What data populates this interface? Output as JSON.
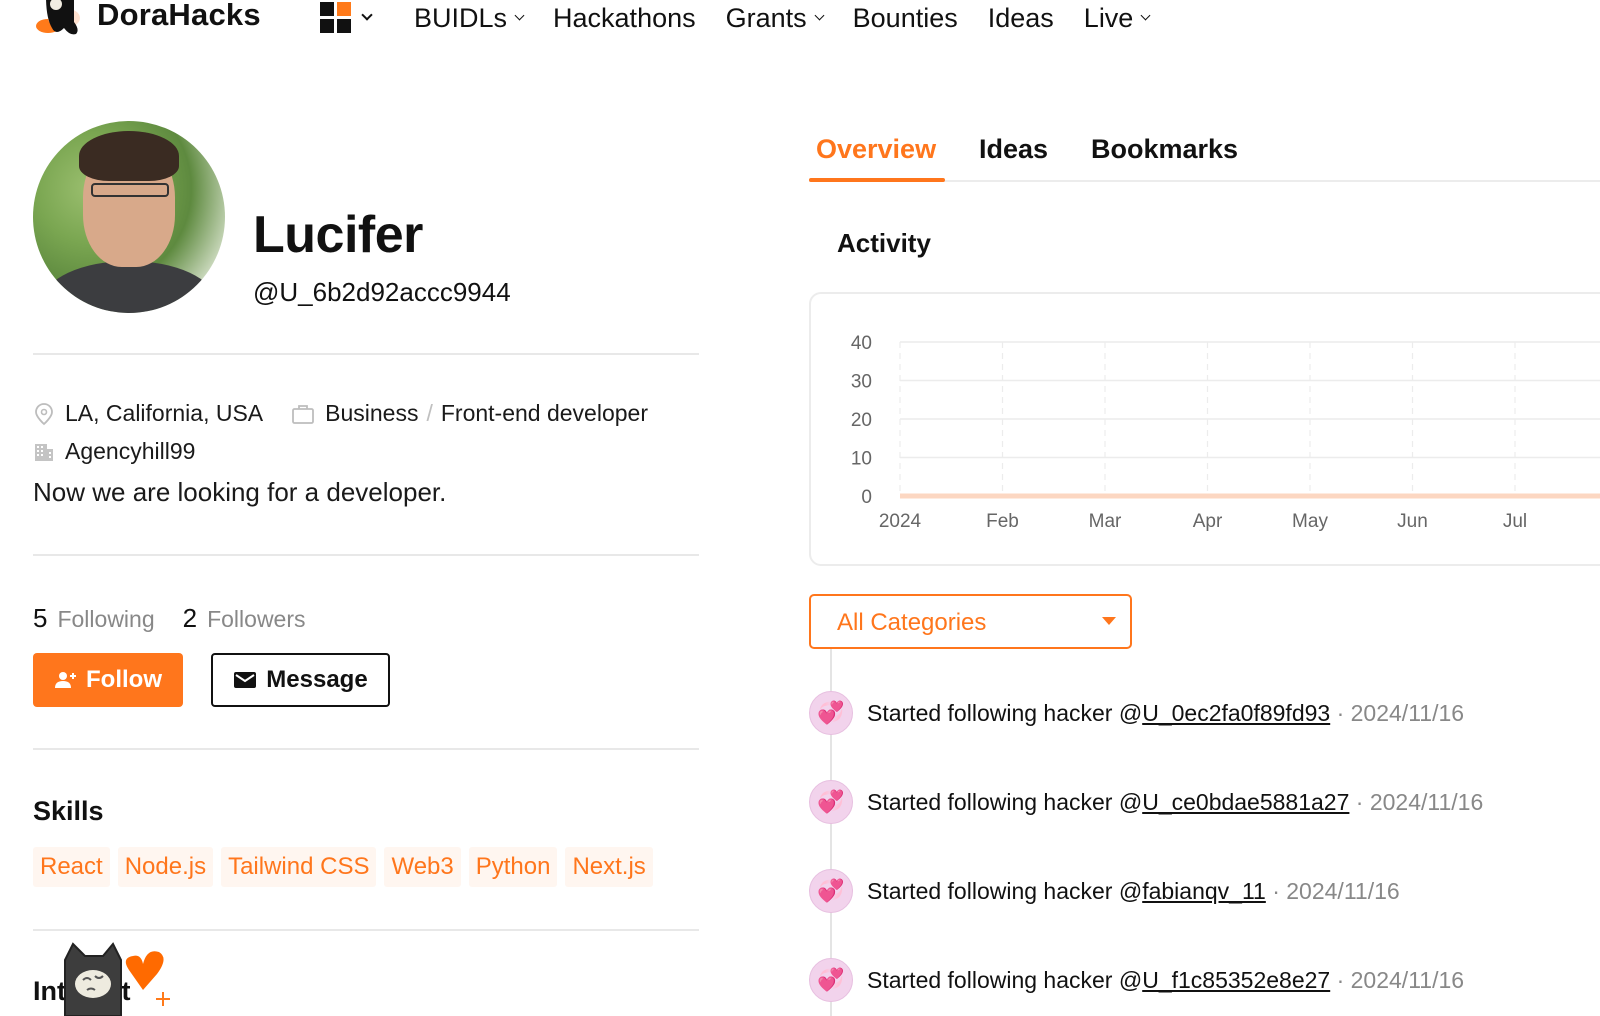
{
  "nav": {
    "brand": "DoraHacks",
    "items": [
      {
        "label": "BUIDLs",
        "has_dropdown": true
      },
      {
        "label": "Hackathons",
        "has_dropdown": false
      },
      {
        "label": "Grants",
        "has_dropdown": true
      },
      {
        "label": "Bounties",
        "has_dropdown": false
      },
      {
        "label": "Ideas",
        "has_dropdown": false
      },
      {
        "label": "Live",
        "has_dropdown": true
      }
    ],
    "apps_icon": "grid-icon"
  },
  "profile": {
    "name": "Lucifer",
    "handle": "@U_6b2d92accc9944",
    "location": "LA, California, USA",
    "role_category": "Business",
    "role_separator": "/",
    "role_title": "Front-end developer",
    "organization": "Agencyhill99",
    "bio": "Now we are looking for a developer.",
    "following_count": "5",
    "following_label": "Following",
    "followers_count": "2",
    "followers_label": "Followers",
    "follow_button": "Follow",
    "message_button": "Message",
    "skills_title": "Skills",
    "skills": [
      "React",
      "Node.js",
      "Tailwind CSS",
      "Web3",
      "Python",
      "Next.js"
    ],
    "interest_title": "Interest"
  },
  "tabs": [
    {
      "label": "Overview",
      "active": true
    },
    {
      "label": "Ideas",
      "active": false
    },
    {
      "label": "Bookmarks",
      "active": false
    }
  ],
  "activity": {
    "title": "Activity",
    "filter": {
      "selected": "All Categories"
    },
    "feed": [
      {
        "prefix": "Started following hacker @",
        "user": "U_0ec2fa0f89fd93",
        "date": "· 2024/11/16"
      },
      {
        "prefix": "Started following hacker @",
        "user": "U_ce0bdae5881a27",
        "date": "· 2024/11/16"
      },
      {
        "prefix": "Started following hacker @",
        "user": "fabianqv_11",
        "date": "· 2024/11/16"
      },
      {
        "prefix": "Started following hacker @",
        "user": "U_f1c85352e8e27",
        "date": "· 2024/11/16"
      }
    ]
  },
  "colors": {
    "accent": "#ff761c",
    "line_series": "#fcd7c2",
    "grid": "#ececec",
    "tick_text": "#666666"
  },
  "chart_data": {
    "type": "area",
    "title": "Activity",
    "xlabel": "",
    "ylabel": "",
    "categories": [
      "2024",
      "Feb",
      "Mar",
      "Apr",
      "May",
      "Jun",
      "Jul"
    ],
    "series": [
      {
        "name": "Activity",
        "values": [
          0,
          0,
          0,
          0,
          0,
          0,
          0
        ]
      }
    ],
    "yticks": [
      0,
      10,
      20,
      30,
      40
    ],
    "ylim": [
      0,
      40
    ],
    "grid": true,
    "legend": "none"
  }
}
